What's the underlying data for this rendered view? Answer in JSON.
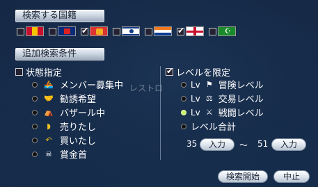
{
  "nation_section": {
    "title": "検索する国籍"
  },
  "nations": [
    {
      "checked": false,
      "colors": [
        "#c8102e",
        "#f5c400"
      ]
    },
    {
      "checked": false,
      "colors": [
        "#0a2a7a",
        "#d22"
      ]
    },
    {
      "checked": true,
      "colors": [
        "#d33",
        "#f0b020"
      ]
    },
    {
      "checked": false,
      "colors": [
        "#fff",
        "#123b8a"
      ]
    },
    {
      "checked": false,
      "colors": [
        "#0b3d91",
        "#f47a1f"
      ]
    },
    {
      "checked": true,
      "colors": [
        "#fff",
        "#c8102e"
      ]
    },
    {
      "checked": false,
      "colors": [
        "#1a8a2a",
        "#fff"
      ]
    }
  ],
  "extra_section": {
    "title": "追加検索条件"
  },
  "status": {
    "label": "状態指定",
    "checked": false,
    "options": [
      {
        "label": "メンバー募集中",
        "icon": "recruiting-icon"
      },
      {
        "label": "勧誘希望",
        "icon": "handshake-icon"
      },
      {
        "label": "バザール中",
        "icon": "bazaar-icon"
      },
      {
        "label": "売りたし",
        "icon": "sell-icon"
      },
      {
        "label": "買いたし",
        "icon": "buy-icon"
      },
      {
        "label": "賞金首",
        "icon": "skull-icon"
      }
    ]
  },
  "level": {
    "label": "レベルを限定",
    "checked": true,
    "options": [
      {
        "prefix": "Lv",
        "label": "冒険レベル",
        "icon": "adventure-icon",
        "active": false
      },
      {
        "prefix": "Lv",
        "label": "交易レベル",
        "icon": "trade-icon",
        "active": false
      },
      {
        "prefix": "Lv",
        "label": "戦闘レベル",
        "icon": "battle-icon",
        "active": true
      },
      {
        "prefix": "",
        "label": "レベル合計",
        "icon": "",
        "active": false
      }
    ],
    "min_value": "35",
    "max_value": "51",
    "range_sep": "～",
    "input_label": "入力"
  },
  "ghost_text": "レストロ",
  "buttons": {
    "search": "検索開始",
    "cancel": "中止"
  }
}
